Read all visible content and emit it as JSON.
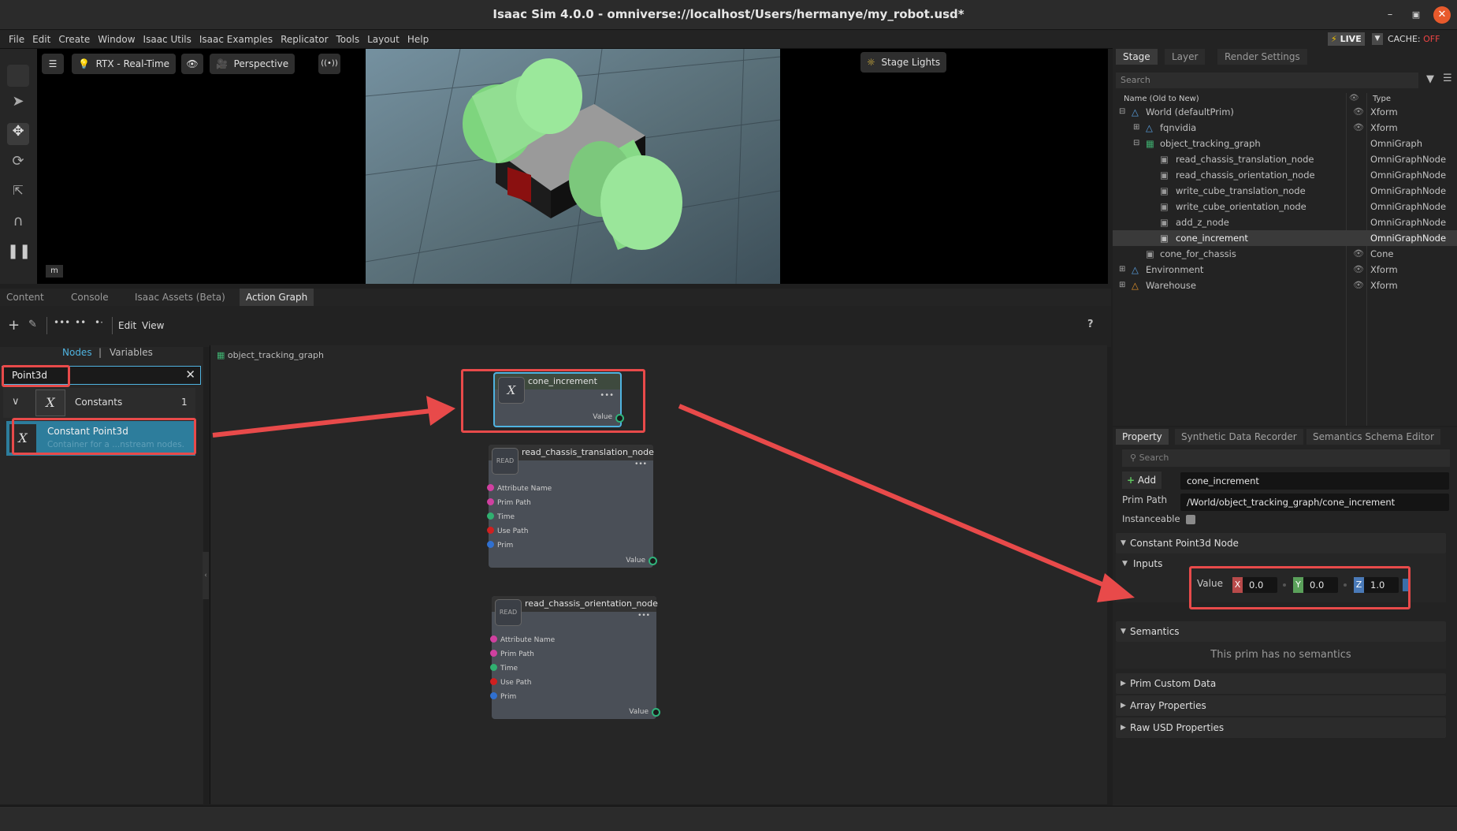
{
  "window": {
    "title": "Isaac Sim 4.0.0 - omniverse://localhost/Users/hermanye/my_robot.usd*"
  },
  "menu": [
    "File",
    "Edit",
    "Create",
    "Window",
    "Isaac Utils",
    "Isaac Examples",
    "Replicator",
    "Tools",
    "Layout",
    "Help"
  ],
  "status": {
    "live": "LIVE",
    "cache_label": "CACHE:",
    "cache_value": "OFF"
  },
  "viewport": {
    "render_mode": "RTX - Real-Time",
    "camera": "Perspective",
    "stage_lights": "Stage Lights",
    "unit": "m"
  },
  "bottom_tabs": [
    "Content",
    "Console",
    "Isaac Assets (Beta)",
    "Action Graph"
  ],
  "graph_toolbar": {
    "edit": "Edit",
    "view": "View",
    "help": "?"
  },
  "node_library": {
    "tab_nodes": "Nodes",
    "separator": "|",
    "tab_variables": "Variables",
    "search_value": "Point3d",
    "category": "Constants",
    "category_count": "1",
    "item_title": "Constant Point3d",
    "item_desc": "Container for a ...nstream nodes."
  },
  "graph": {
    "breadcrumb": "object_tracking_graph",
    "nodes": [
      {
        "title": "cone_increment",
        "badge": "X",
        "output": "Value"
      },
      {
        "title": "read_chassis_translation_node",
        "badge": "READ",
        "ports": [
          "Attribute Name",
          "Prim Path",
          "Time",
          "Use Path",
          "Prim"
        ],
        "output": "Value"
      },
      {
        "title": "read_chassis_orientation_node",
        "badge": "READ",
        "ports": [
          "Attribute Name",
          "Prim Path",
          "Time",
          "Use Path",
          "Prim"
        ],
        "output": "Value"
      }
    ]
  },
  "stage": {
    "tabs": [
      "Stage",
      "Layer",
      "Render Settings"
    ],
    "search_placeholder": "Search",
    "col_name": "Name (Old to New)",
    "col_type": "Type",
    "rows": [
      {
        "name": "World (defaultPrim)",
        "type": "Xform"
      },
      {
        "name": "fqnvidia",
        "type": "Xform"
      },
      {
        "name": "object_tracking_graph",
        "type": "OmniGraph"
      },
      {
        "name": "read_chassis_translation_node",
        "type": "OmniGraphNode"
      },
      {
        "name": "read_chassis_orientation_node",
        "type": "OmniGraphNode"
      },
      {
        "name": "write_cube_translation_node",
        "type": "OmniGraphNode"
      },
      {
        "name": "write_cube_orientation_node",
        "type": "OmniGraphNode"
      },
      {
        "name": "add_z_node",
        "type": "OmniGraphNode"
      },
      {
        "name": "cone_increment",
        "type": "OmniGraphNode"
      },
      {
        "name": "cone_for_chassis",
        "type": "Cone"
      },
      {
        "name": "Environment",
        "type": "Xform"
      },
      {
        "name": "Warehouse",
        "type": "Xform"
      }
    ]
  },
  "property": {
    "tabs": [
      "Property",
      "Synthetic Data Recorder",
      "Semantics Schema Editor"
    ],
    "search_placeholder": "Search",
    "add_label": "Add",
    "prim_name": "cone_increment",
    "prim_path_label": "Prim Path",
    "prim_path": "/World/object_tracking_graph/cone_increment",
    "instanceable_label": "Instanceable",
    "node_section": "Constant Point3d Node",
    "inputs_label": "Inputs",
    "value_label": "Value",
    "value": {
      "x": "0.0",
      "y": "0.0",
      "z": "1.0"
    },
    "axis": {
      "x": "X",
      "y": "Y",
      "z": "Z"
    },
    "semantics_section": "Semantics",
    "no_semantics": "This prim has no semantics",
    "sections": [
      "Prim Custom Data",
      "Array Properties",
      "Raw USD Properties"
    ]
  },
  "colors": {
    "accent": "#4fb3e0",
    "highlight": "#e84a4a",
    "selected_node": "#4fb3e0"
  }
}
